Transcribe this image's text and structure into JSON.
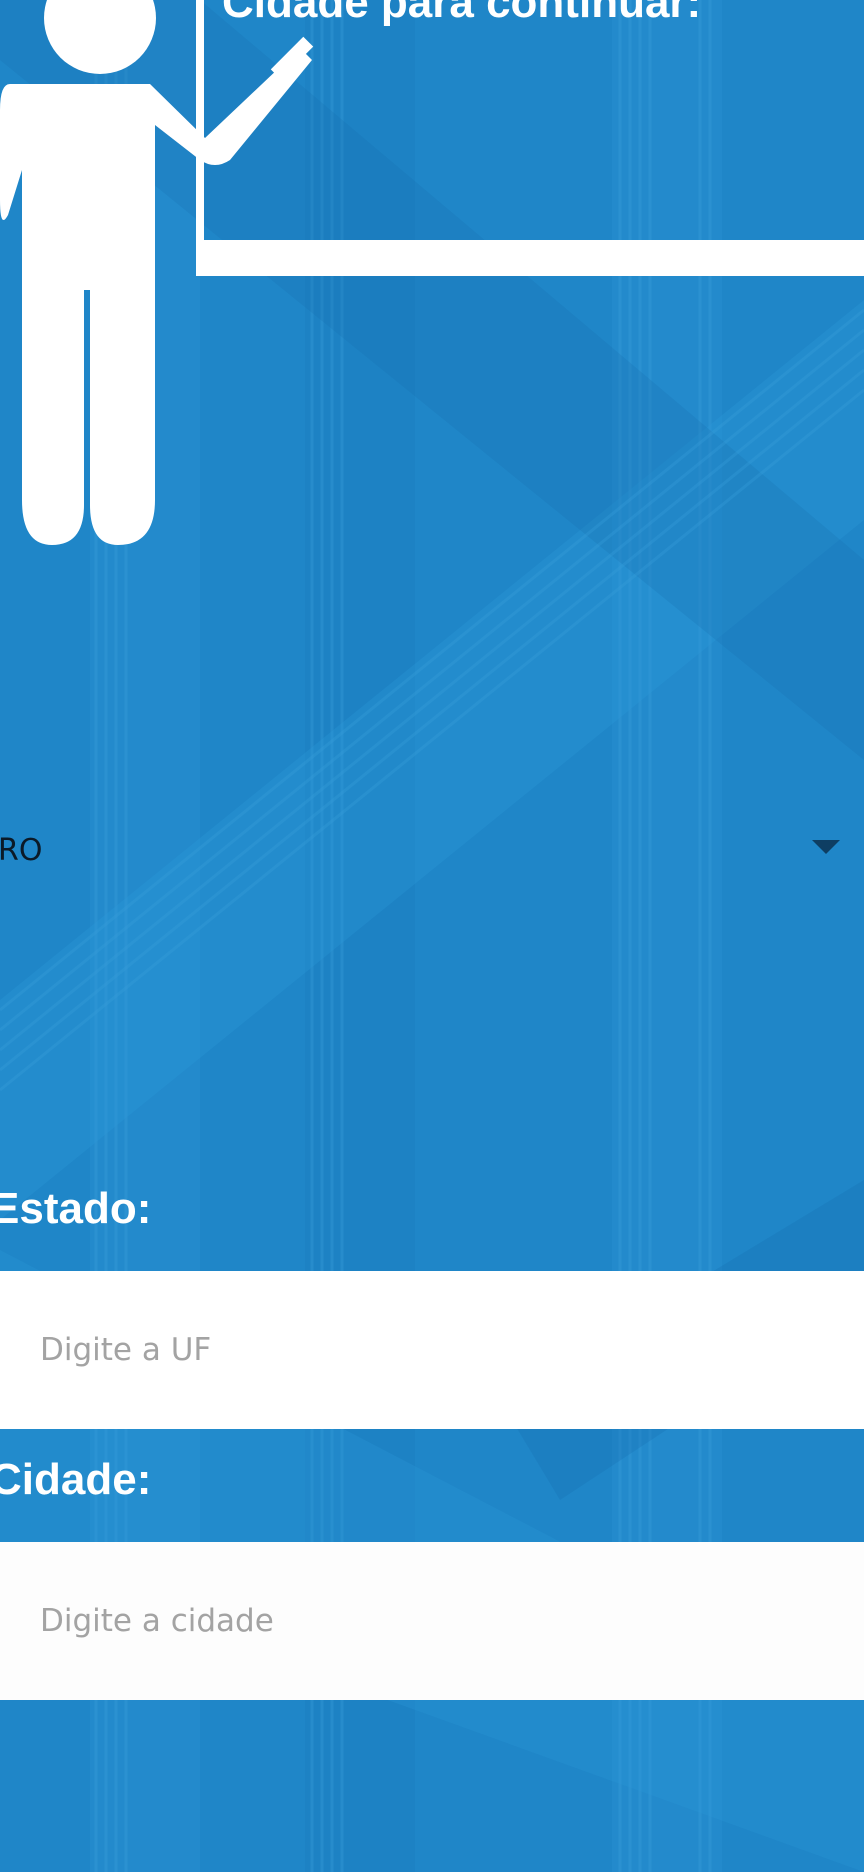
{
  "header": {
    "title": "Cidade para continuar:"
  },
  "state_select": {
    "selected": "RO",
    "icon": "caret-down-icon"
  },
  "form": {
    "estado_label": "Estado:",
    "uf_placeholder": "Digite a UF",
    "uf_value": "",
    "cidade_label": "Cidade:",
    "cidade_placeholder": "Digite a cidade",
    "cidade_value": ""
  },
  "colors": {
    "background": "#1f86c8",
    "foreground": "#ffffff",
    "caret": "#0e3e63"
  },
  "illustration": {
    "icon": "teacher-presenting-icon"
  }
}
